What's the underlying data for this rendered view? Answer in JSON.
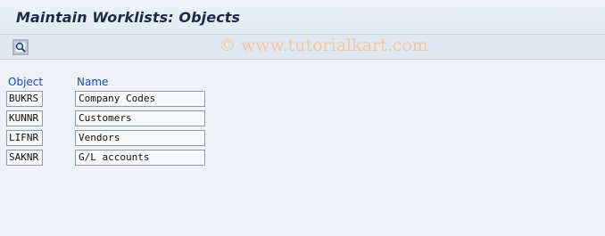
{
  "window": {
    "title": "Maintain Worklists: Objects"
  },
  "toolbar": {
    "display_icon": "magnifier-display-icon"
  },
  "watermark": "© www.tutorialkart.com",
  "table": {
    "headers": {
      "object": "Object",
      "name": "Name"
    },
    "rows": [
      {
        "object": "BUKRS",
        "name": "Company Codes"
      },
      {
        "object": "KUNNR",
        "name": "Customers"
      },
      {
        "object": "LIFNR",
        "name": "Vendors"
      },
      {
        "object": "SAKNR",
        "name": "G/L accounts"
      }
    ]
  },
  "colors": {
    "header_text": "#1b48b0",
    "title_text": "#1b2b48",
    "background": "#eef2f6"
  }
}
